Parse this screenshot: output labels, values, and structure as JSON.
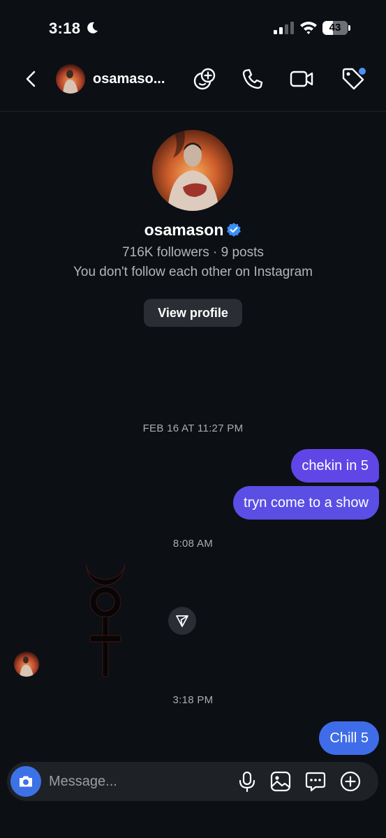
{
  "status_bar": {
    "time": "3:18",
    "battery": "43",
    "battery_level": 0.43,
    "icons": [
      "moon-icon",
      "signal-icon",
      "wifi-icon",
      "battery-icon"
    ]
  },
  "header": {
    "name": "osamaso...",
    "icons": [
      "back-icon",
      "add-people-icon",
      "phone-icon",
      "video-icon",
      "tag-icon"
    ],
    "accent_dot_color": "#4d8ff9"
  },
  "profile": {
    "name": "osamason",
    "stats": "716K followers · 9 posts",
    "follow_status": "You don't follow each other on Instagram",
    "view_profile_label": "View profile",
    "verified_color": "#3b8ff5"
  },
  "messages": {
    "timestamp_1": "FEB 16 AT 11:27 PM",
    "sent_1": "chekin in 5",
    "sent_2": "tryn come to a show",
    "timestamp_2": "8:08 AM",
    "timestamp_3": "3:18 PM",
    "sent_3": "Chill 5"
  },
  "composer": {
    "placeholder": "Message...",
    "icons": [
      "camera-icon",
      "microphone-icon",
      "gallery-icon",
      "sticker-chat-icon",
      "plus-icon"
    ]
  },
  "colors": {
    "background": "#0c0f14",
    "bubble_purple": "#6046e6",
    "bubble_blue": "#3f6de9",
    "camera_blue": "#3c72e6"
  }
}
